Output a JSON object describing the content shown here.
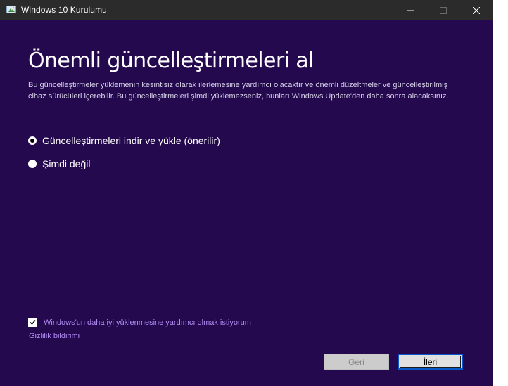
{
  "window": {
    "title": "Windows 10 Kurulumu"
  },
  "page": {
    "heading": "Önemli güncelleştirmeleri al",
    "description": "Bu güncelleştirmeler yüklemenin kesintisiz olarak ilerlemesine yardımcı olacaktır ve önemli düzeltmeler ve güncelleştirilmiş cihaz sürücüleri içerebilir. Bu güncelleştirmeleri şimdi yüklemezseniz, bunları Windows Update'den daha sonra alacaksınız."
  },
  "options": [
    {
      "label": "Güncelleştirmeleri indir ve yükle (önerilir)",
      "selected": true
    },
    {
      "label": "Şimdi değil",
      "selected": false
    }
  ],
  "feedback": {
    "label": "Windows'un daha iyi yüklenmesine yardımcı olmak istiyorum",
    "checked": true
  },
  "privacy_link": "Gizlilik bildirimi",
  "buttons": {
    "back": "Geri",
    "next": "İleri"
  },
  "colors": {
    "background": "#24094f",
    "titlebar": "#2b2b2b",
    "link": "#b48cf5",
    "focus_border": "#0a58c8"
  },
  "icons": [
    "setup-app-icon",
    "minimize-icon",
    "maximize-icon",
    "close-icon",
    "checkmark-icon"
  ]
}
